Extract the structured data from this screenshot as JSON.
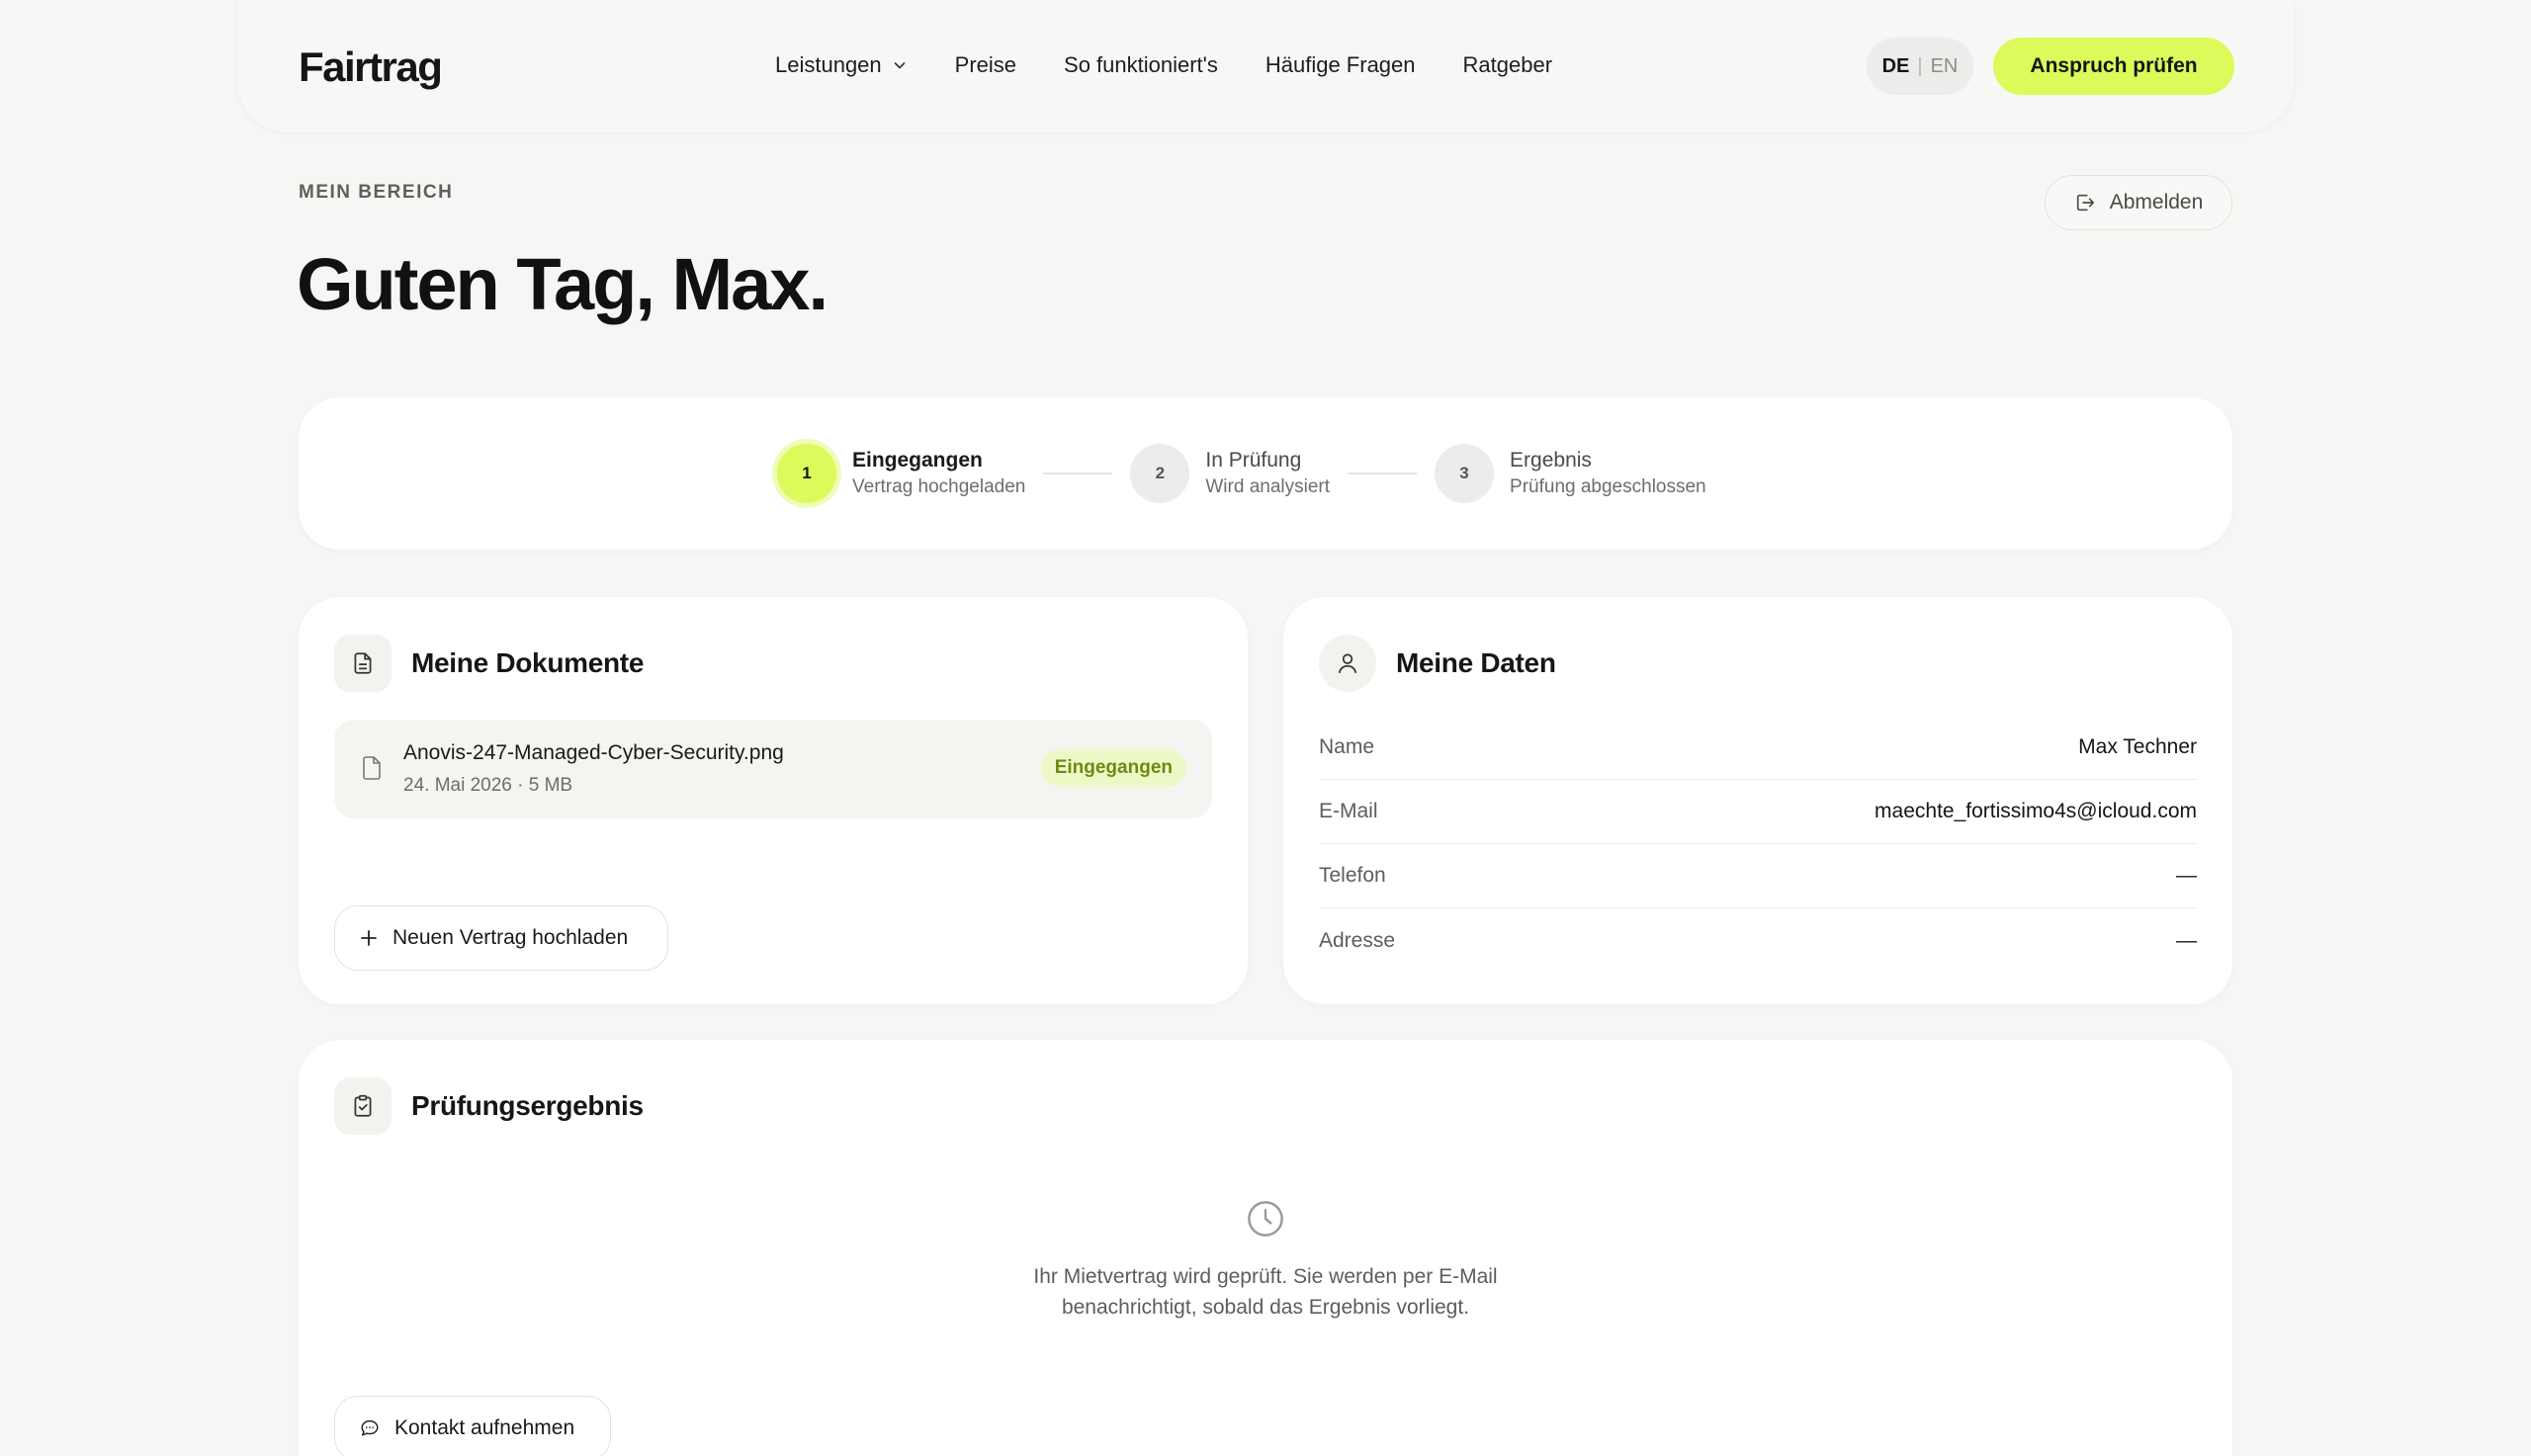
{
  "header": {
    "logo": "Fairtrag",
    "nav": [
      {
        "label": "Leistungen",
        "has_dropdown": true
      },
      {
        "label": "Preise"
      },
      {
        "label": "So funktioniert's"
      },
      {
        "label": "Häufige Fragen"
      },
      {
        "label": "Ratgeber"
      }
    ],
    "lang": {
      "active": "DE",
      "separator": "|",
      "other": "EN"
    },
    "cta_label": "Anspruch prüfen"
  },
  "page": {
    "eyebrow": "MEIN BEREICH",
    "greeting": "Guten Tag, Max.",
    "logout_label": "Abmelden"
  },
  "stepper": {
    "steps": [
      {
        "number": "1",
        "title": "Eingegangen",
        "subtitle": "Vertrag hochgeladen",
        "active": true
      },
      {
        "number": "2",
        "title": "In Prüfung",
        "subtitle": "Wird analysiert",
        "active": false
      },
      {
        "number": "3",
        "title": "Ergebnis",
        "subtitle": "Prüfung abgeschlossen",
        "active": false
      }
    ]
  },
  "documents": {
    "title": "Meine Dokumente",
    "files": [
      {
        "name": "Anovis-247-Managed-Cyber-Security.png",
        "meta": "24. Mai 2026 · 5 MB",
        "status": "Eingegangen"
      }
    ],
    "upload_label": "Neuen Vertrag hochladen"
  },
  "personal_data": {
    "title": "Meine Daten",
    "rows": [
      {
        "label": "Name",
        "value": "Max Techner"
      },
      {
        "label": "E-Mail",
        "value": "maechte_fortissimo4s@icloud.com"
      },
      {
        "label": "Telefon",
        "value": "—"
      },
      {
        "label": "Adresse",
        "value": "—"
      }
    ]
  },
  "result": {
    "title": "Prüfungsergebnis",
    "message": "Ihr Mietvertrag wird geprüft. Sie werden per E-Mail benachrichtigt, sobald das Ergebnis vorliegt.",
    "contact_label": "Kontakt aufnehmen"
  },
  "colors": {
    "accent": "#dcfa5a",
    "background": "#f6f6f4",
    "badge_text": "#6b8a12"
  }
}
